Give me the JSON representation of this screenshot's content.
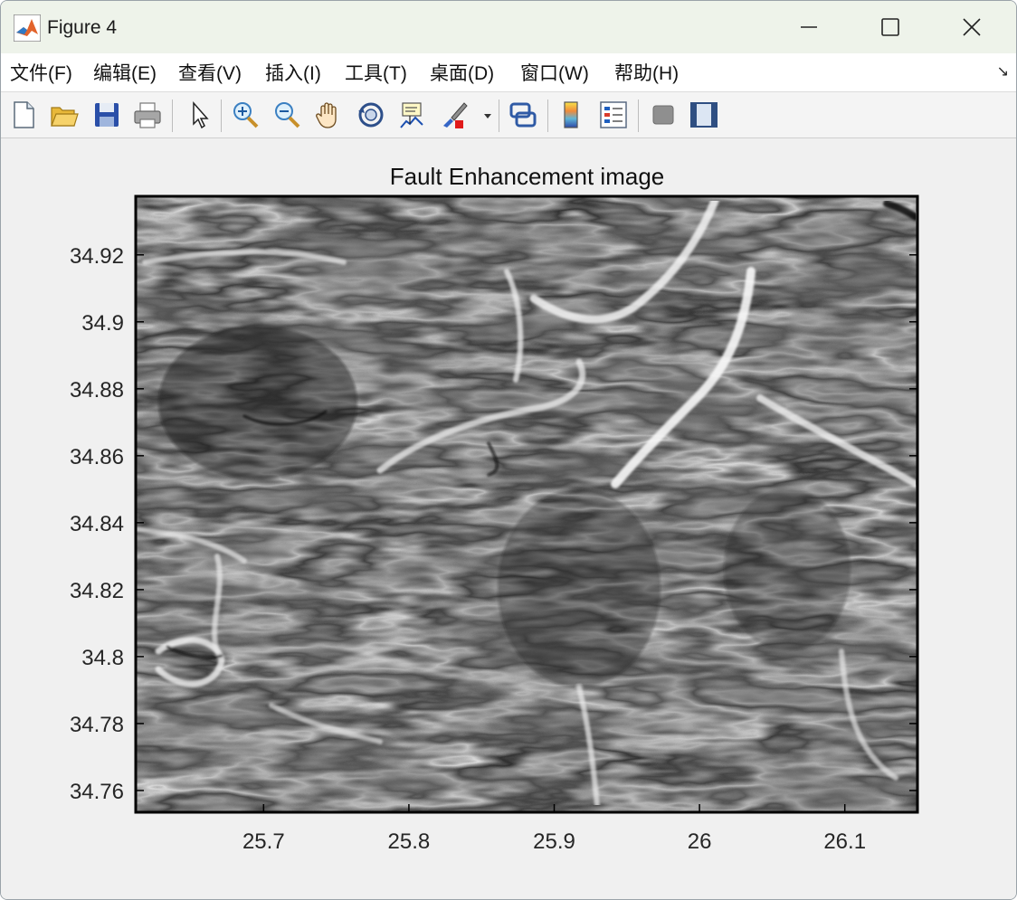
{
  "window": {
    "title": "Figure 4",
    "app_icon": "matlab-icon",
    "controls": [
      "minimize-icon",
      "maximize-icon",
      "close-icon"
    ]
  },
  "menu": {
    "items": [
      {
        "label": "文件(F)"
      },
      {
        "label": "编辑(E)"
      },
      {
        "label": "查看(V)"
      },
      {
        "label": "插入(I)"
      },
      {
        "label": "工具(T)"
      },
      {
        "label": "桌面(D)"
      },
      {
        "label": "窗口(W)"
      },
      {
        "label": "帮助(H)"
      }
    ],
    "dock_icon": "dock-arrow-icon"
  },
  "toolbar": {
    "buttons": [
      "new-figure-icon",
      "open-file-icon",
      "save-icon",
      "print-icon",
      "edit-plot-icon",
      "zoom-in-icon",
      "zoom-out-icon",
      "pan-icon",
      "rotate-3d-icon",
      "data-cursor-icon",
      "brush-icon",
      "link-plot-icon",
      "colorbar-icon",
      "legend-icon",
      "hide-plot-tools-icon",
      "show-plot-tools-icon"
    ]
  },
  "figure": {
    "title": "Fault Enhancement image",
    "x_ticks": [
      "25.7",
      "25.8",
      "25.9",
      "26",
      "26.1"
    ],
    "y_ticks": [
      "34.92",
      "34.9",
      "34.88",
      "34.86",
      "34.84",
      "34.82",
      "34.8",
      "34.78",
      "34.76"
    ],
    "xlim": [
      25.612,
      26.15
    ],
    "ylim": [
      34.7535,
      34.9375
    ],
    "colormap": "gray"
  }
}
